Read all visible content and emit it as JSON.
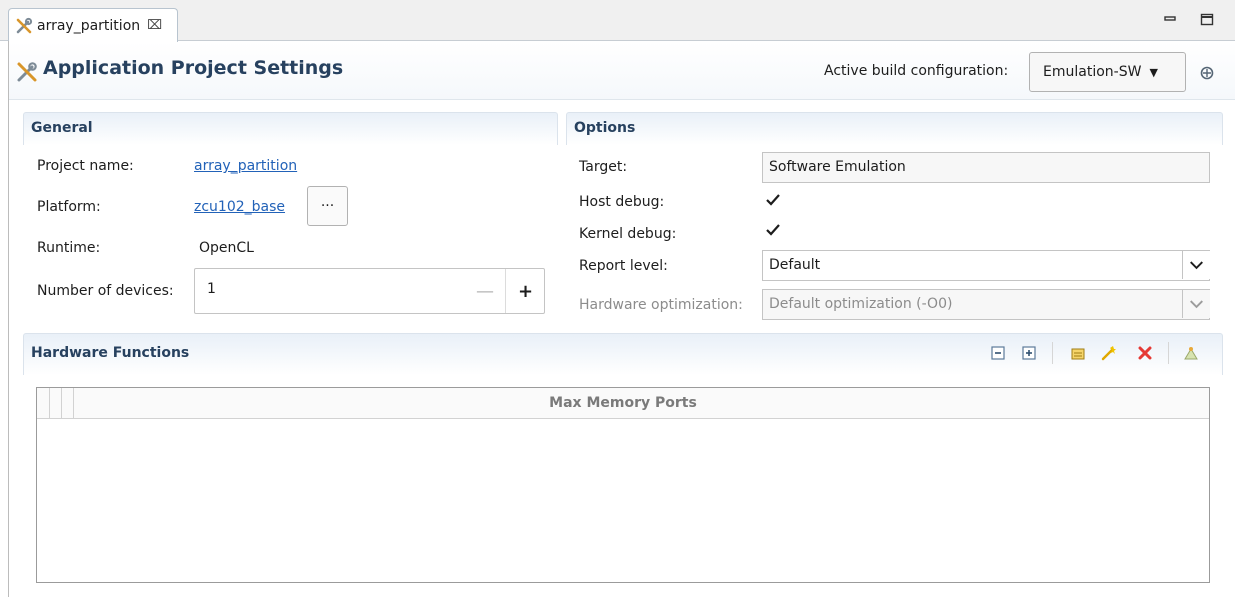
{
  "editor_tab": {
    "title": "array_partition",
    "close_glyph": "⌧",
    "icon": "tools-icon"
  },
  "window_controls": {
    "minimize_icon": "minimize-icon",
    "maximize_icon": "maximize-icon"
  },
  "header": {
    "title": "Application Project Settings",
    "icon": "tools-icon",
    "build_config_label": "Active build configuration:",
    "build_config_value": "Emulation-SW",
    "build_icon": "hammer-icon"
  },
  "general": {
    "section_title": "General",
    "project_name_label": "Project name:",
    "project_name_value": "array_partition",
    "platform_label": "Platform:",
    "platform_value": "zcu102_base",
    "browse_label": "···",
    "runtime_label": "Runtime:",
    "runtime_value": "OpenCL",
    "devices_label": "Number of devices:",
    "devices_value": "1",
    "minus_glyph": "—",
    "plus_glyph": "+"
  },
  "options": {
    "section_title": "Options",
    "target_label": "Target:",
    "target_value": "Software Emulation",
    "host_debug_label": "Host debug:",
    "host_debug_checked": true,
    "kernel_debug_label": "Kernel debug:",
    "kernel_debug_checked": true,
    "report_level_label": "Report level:",
    "report_level_value": "Default",
    "hw_opt_label": "Hardware optimization:",
    "hw_opt_value": "Default optimization (-O0)",
    "hw_opt_enabled": false
  },
  "hardware_functions": {
    "section_title": "Hardware Functions",
    "toolbar": [
      "collapse-all-icon",
      "expand-all-icon",
      "add-function-icon",
      "edit-function-icon",
      "delete-icon",
      "settings-icon"
    ],
    "table_header": "Max Memory Ports",
    "rows": []
  },
  "colors": {
    "accent": "#27415f",
    "link": "#2262b8",
    "section_gradient": "#e9f0f8",
    "delete": "#e53935",
    "wand": "#f0b400"
  }
}
